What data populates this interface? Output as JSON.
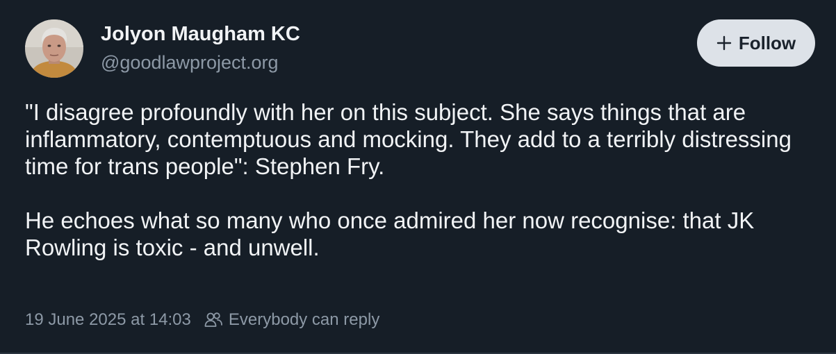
{
  "post": {
    "author": {
      "display_name": "Jolyon Maugham KC",
      "handle": "@goodlawproject.org",
      "avatar_icon": "avatar-photo"
    },
    "follow_button": {
      "label": "Follow",
      "icon": "plus-icon"
    },
    "body": {
      "paragraphs": [
        "\"I disagree profoundly with her on this subject. She says things that are inflammatory, contemptuous and mocking. They add to a terribly distressing time for trans people\": Stephen Fry.",
        "He echoes what so many who once admired her now recognise: that JK Rowling is toxic - and unwell."
      ]
    },
    "meta": {
      "timestamp": "19 June 2025 at 14:03",
      "reply_setting": "Everybody can reply",
      "reply_icon": "people-icon"
    }
  },
  "colors": {
    "background": "#161e27",
    "text": "#f1f3f5",
    "muted": "#8d99a6",
    "button_bg": "#dde2e8",
    "button_text": "#1a222c"
  }
}
